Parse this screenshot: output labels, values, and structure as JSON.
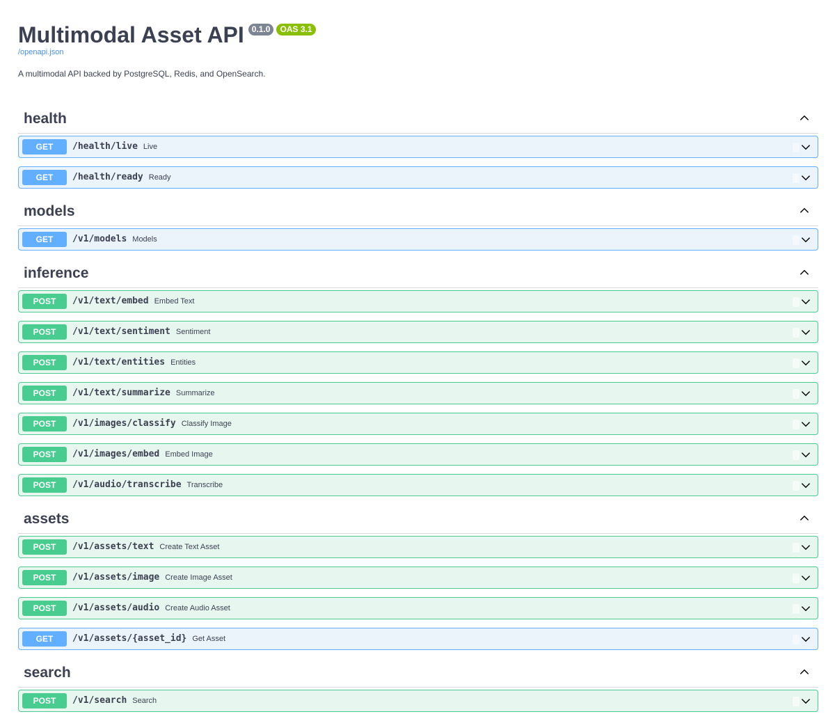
{
  "info": {
    "title": "Multimodal Asset API",
    "version_badge": "0.1.0",
    "oas_badge": "OAS 3.1",
    "spec_link": "/openapi.json",
    "description": "A multimodal API backed by PostgreSQL, Redis, and OpenSearch."
  },
  "colors": {
    "get": "#61affe",
    "post": "#49cc90",
    "get_bg": "#ebf3fb",
    "post_bg": "#e8f6f0",
    "text": "#3b4151",
    "link": "#4990e2",
    "oas_badge": "#89bf04",
    "version_badge": "#7d8492"
  },
  "tags": [
    {
      "name": "health",
      "toggle_icon": "chevron-up-icon",
      "operations": [
        {
          "method": "GET",
          "path": "/health/live",
          "summary": "Live"
        },
        {
          "method": "GET",
          "path": "/health/ready",
          "summary": "Ready"
        }
      ]
    },
    {
      "name": "models",
      "toggle_icon": "chevron-up-icon",
      "operations": [
        {
          "method": "GET",
          "path": "/v1/models",
          "summary": "Models"
        }
      ]
    },
    {
      "name": "inference",
      "toggle_icon": "chevron-up-icon",
      "operations": [
        {
          "method": "POST",
          "path": "/v1/text/embed",
          "summary": "Embed Text"
        },
        {
          "method": "POST",
          "path": "/v1/text/sentiment",
          "summary": "Sentiment"
        },
        {
          "method": "POST",
          "path": "/v1/text/entities",
          "summary": "Entities"
        },
        {
          "method": "POST",
          "path": "/v1/text/summarize",
          "summary": "Summarize"
        },
        {
          "method": "POST",
          "path": "/v1/images/classify",
          "summary": "Classify Image"
        },
        {
          "method": "POST",
          "path": "/v1/images/embed",
          "summary": "Embed Image"
        },
        {
          "method": "POST",
          "path": "/v1/audio/transcribe",
          "summary": "Transcribe"
        }
      ]
    },
    {
      "name": "assets",
      "toggle_icon": "chevron-up-icon",
      "operations": [
        {
          "method": "POST",
          "path": "/v1/assets/text",
          "summary": "Create Text Asset"
        },
        {
          "method": "POST",
          "path": "/v1/assets/image",
          "summary": "Create Image Asset"
        },
        {
          "method": "POST",
          "path": "/v1/assets/audio",
          "summary": "Create Audio Asset"
        },
        {
          "method": "GET",
          "path": "/v1/assets/{asset_id}",
          "summary": "Get Asset"
        }
      ]
    },
    {
      "name": "search",
      "toggle_icon": "chevron-up-icon",
      "operations": [
        {
          "method": "POST",
          "path": "/v1/search",
          "summary": "Search"
        }
      ]
    }
  ]
}
